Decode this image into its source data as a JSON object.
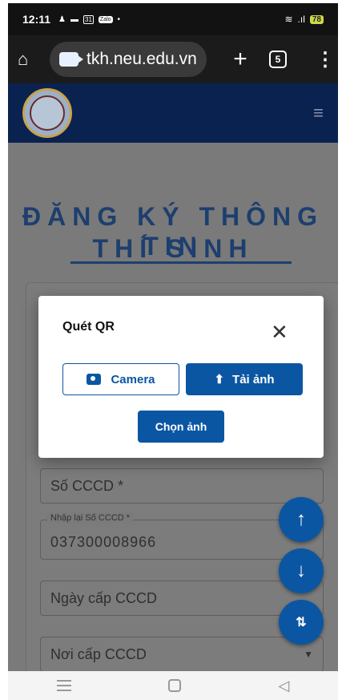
{
  "status_bar": {
    "time": "12:11",
    "icons": [
      "person-icon",
      "dash-icon",
      "calendar-icon",
      "chat-icon",
      "dot-icon"
    ],
    "calendar_text": "31",
    "zalo_text": "Zalo",
    "signal": "wifi-signal",
    "battery_level": "78"
  },
  "browser": {
    "url": "tkh.neu.edu.vn",
    "tab_count": "5"
  },
  "page": {
    "title_line1": "ĐĂNG KÝ THÔNG TIN",
    "title_line2": "THÍ SINH"
  },
  "form": {
    "cccd_placeholder": "Số CCCD *",
    "confirm_cccd_label": "Nhập lại Số CCCD *",
    "confirm_cccd_value": "037300008966",
    "issue_date_placeholder": "Ngày cấp CCCD",
    "issue_place_placeholder": "Nơi cấp CCCD"
  },
  "modal": {
    "title": "Quét QR",
    "camera_label": "Camera",
    "upload_label": "Tải ảnh",
    "choose_label": "Chọn ảnh"
  },
  "colors": {
    "primary": "#0b56a3",
    "header": "#0a2250",
    "title": "#1d3f6e"
  }
}
